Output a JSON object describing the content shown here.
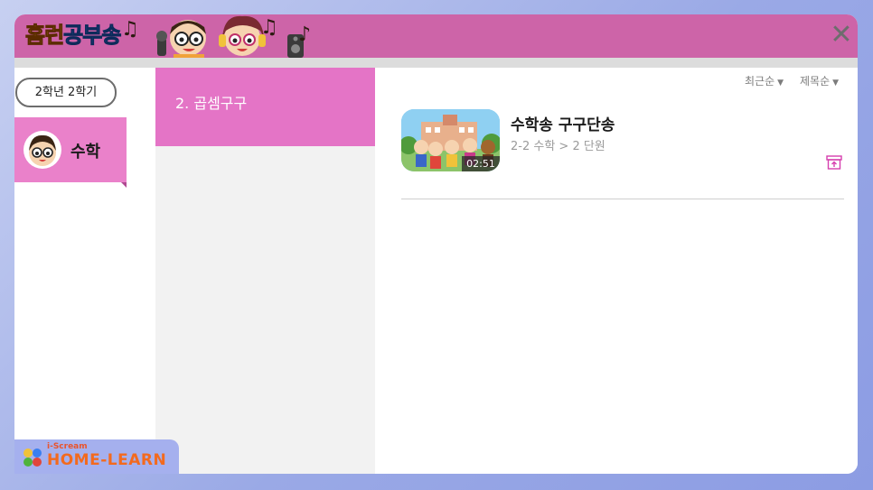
{
  "header": {
    "title_part1": "홈런",
    "title_part2": "공부송",
    "close_label": "✕"
  },
  "grade_button": {
    "label": "2학년 2학기"
  },
  "subjects": [
    {
      "label": "수학",
      "selected": true
    }
  ],
  "units": [
    {
      "label": "2. 곱셈구구",
      "selected": true
    }
  ],
  "sort_options": [
    {
      "label": "최근순"
    },
    {
      "label": "제목순"
    }
  ],
  "videos": [
    {
      "title": "수학송 구구단송",
      "path": "2-2 수학 > 2 단원",
      "duration": "02:51"
    }
  ],
  "brand": {
    "small": "i-Scream",
    "big": "HOME-LEARN"
  },
  "colors": {
    "header": "#cd64a8",
    "subject_selected": "#ea81ca",
    "unit_selected": "#e474c6",
    "accent_icon": "#d63fae"
  }
}
